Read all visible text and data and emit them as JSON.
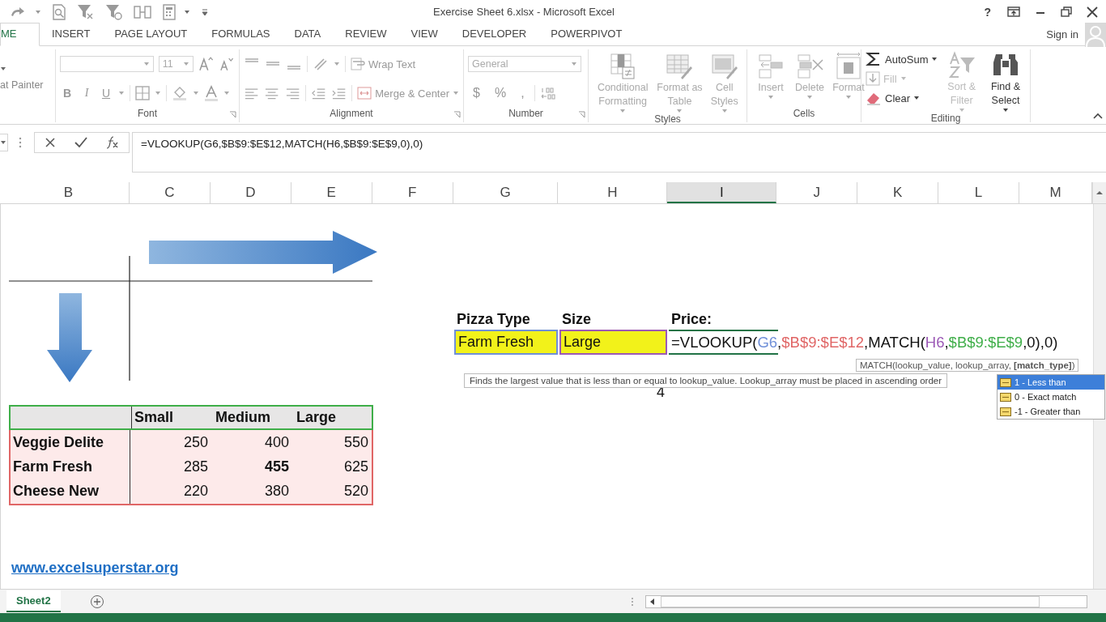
{
  "title_bar": {
    "title": "Exercise Sheet 6.xlsx - Microsoft Excel",
    "help": "?"
  },
  "tabs": [
    {
      "label": "ME",
      "selected": true
    },
    {
      "label": "INSERT",
      "selected": false
    },
    {
      "label": "PAGE LAYOUT",
      "selected": false
    },
    {
      "label": "FORMULAS",
      "selected": false
    },
    {
      "label": "DATA",
      "selected": false
    },
    {
      "label": "REVIEW",
      "selected": false
    },
    {
      "label": "VIEW",
      "selected": false
    },
    {
      "label": "DEVELOPER",
      "selected": false
    },
    {
      "label": "POWERPIVOT",
      "selected": false
    }
  ],
  "account": {
    "sign_in": "Sign in"
  },
  "ribbon": {
    "clipboard": {
      "format_painter": "at Painter"
    },
    "font": {
      "label": "Font",
      "size": "11",
      "styles": [
        "B",
        "I",
        "U"
      ]
    },
    "alignment": {
      "label": "Alignment",
      "wrap_text": "Wrap Text",
      "merge": "Merge & Center"
    },
    "number": {
      "label": "Number",
      "format": "General",
      "symbols": [
        "$",
        "%",
        ","
      ]
    },
    "styles": {
      "label": "Styles",
      "buttons": [
        {
          "label": "Conditional Formatting",
          "kind": "conditional"
        },
        {
          "label": "Format as Table",
          "kind": "table"
        },
        {
          "label": "Cell Styles",
          "kind": "cellstyles"
        }
      ]
    },
    "cells": {
      "label": "Cells",
      "buttons": [
        {
          "label": "Insert",
          "kind": "insert"
        },
        {
          "label": "Delete",
          "kind": "delete"
        },
        {
          "label": "Format",
          "kind": "format"
        }
      ]
    },
    "editing": {
      "label": "Editing",
      "items": [
        {
          "label": "AutoSum",
          "kind": "autosum",
          "disabled": false
        },
        {
          "label": "Fill",
          "kind": "fill",
          "disabled": true
        },
        {
          "label": "Clear",
          "kind": "clear",
          "disabled": false
        },
        {
          "label": "Sort & Filter",
          "kind": "sort",
          "disabled": true
        },
        {
          "label": "Find & Select",
          "kind": "find",
          "disabled": false
        }
      ]
    }
  },
  "formula_bar": {
    "formula": "=VLOOKUP(G6,$B$9:$E$12,MATCH(H6,$B$9:$E$9,0),0)"
  },
  "columns": [
    {
      "label": "B",
      "selected": false
    },
    {
      "label": "C",
      "selected": false
    },
    {
      "label": "D",
      "selected": false
    },
    {
      "label": "E",
      "selected": false
    },
    {
      "label": "F",
      "selected": false
    },
    {
      "label": "G",
      "selected": false
    },
    {
      "label": "H",
      "selected": false
    },
    {
      "label": "I",
      "selected": true
    },
    {
      "label": "J",
      "selected": false
    },
    {
      "label": "K",
      "selected": false
    },
    {
      "label": "L",
      "selected": false
    },
    {
      "label": "M",
      "selected": false
    }
  ],
  "lookup": {
    "headers": [
      "Pizza Type",
      "Size",
      "Price:"
    ],
    "inputs": [
      {
        "value": "Farm Fresh",
        "color": "#6f8fd8"
      },
      {
        "value": "Large",
        "color": "#9b59b6"
      }
    ],
    "formula_parts": [
      {
        "text": "=VLOOKUP(",
        "kind": "plain"
      },
      {
        "text": "G6",
        "kind": "ref",
        "color": "#6f8fd8"
      },
      {
        "text": ",",
        "kind": "plain"
      },
      {
        "text": "$B$9:$E$12",
        "kind": "ref",
        "color": "#e06666"
      },
      {
        "text": ",MATCH(",
        "kind": "plain"
      },
      {
        "text": "H6",
        "kind": "ref",
        "color": "#9b59b6"
      },
      {
        "text": ",",
        "kind": "plain"
      },
      {
        "text": "$B$9:$E$9",
        "kind": "ref",
        "color": "#3fae49"
      },
      {
        "text": ",0),0)",
        "kind": "plain"
      }
    ],
    "result": "4"
  },
  "price_table": {
    "columns": [
      "Small",
      "Medium",
      "Large"
    ],
    "rows": [
      {
        "name": "Veggie Delite",
        "values": [
          {
            "text": "250",
            "bold": false
          },
          {
            "text": "400",
            "bold": false
          },
          {
            "text": "550",
            "bold": false
          }
        ]
      },
      {
        "name": "Farm Fresh",
        "values": [
          {
            "text": "285",
            "bold": false
          },
          {
            "text": "455",
            "bold": true
          },
          {
            "text": "625",
            "bold": false
          }
        ]
      },
      {
        "name": "Cheese New",
        "values": [
          {
            "text": "220",
            "bold": false
          },
          {
            "text": "380",
            "bold": false
          },
          {
            "text": "520",
            "bold": false
          }
        ]
      }
    ]
  },
  "link": "www.excelsuperstar.org",
  "tooltips": {
    "syntax": "MATCH(lookup_value, lookup_array, **[match_type]**)",
    "description": "Finds the largest value that is less than or equal to lookup_value. Lookup_array must be placed in ascending order"
  },
  "match_type_options": [
    {
      "label": "1 - Less than",
      "selected": true
    },
    {
      "label": "0 - Exact match",
      "selected": false
    },
    {
      "label": "-1 - Greater than",
      "selected": false
    }
  ],
  "sheet_tabs": [
    {
      "label": "Sheet2",
      "selected": true
    }
  ]
}
